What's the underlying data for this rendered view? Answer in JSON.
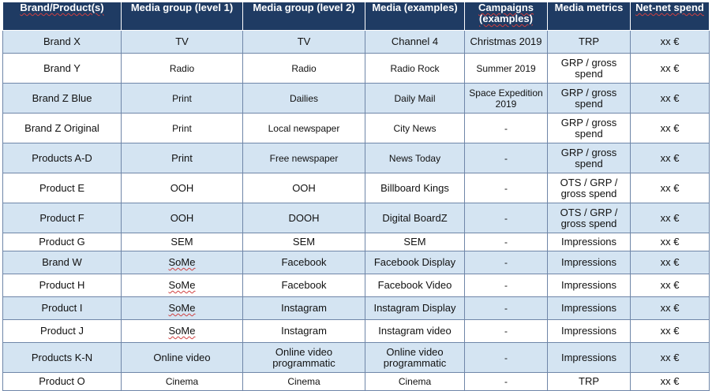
{
  "table": {
    "headers": [
      "Brand/Product(s)",
      "Media group (level 1)",
      "Media group (level 2)",
      "Media (examples)",
      "Campaigns (examples)",
      "Media metrics",
      "Net-net spend"
    ],
    "rows": [
      [
        "Brand X",
        "TV",
        "TV",
        "Channel 4",
        "Christmas 2019",
        "TRP",
        "xx €"
      ],
      [
        "Brand Y",
        "Radio",
        "Radio",
        "Radio Rock",
        "Summer 2019",
        "GRP / gross spend",
        "xx €"
      ],
      [
        "Brand Z Blue",
        "Print",
        "Dailies",
        "Daily Mail",
        "Space Expedition 2019",
        "GRP / gross spend",
        "xx €"
      ],
      [
        "Brand Z Original",
        "Print",
        "Local newspaper",
        "City News",
        "-",
        "GRP / gross spend",
        "xx €"
      ],
      [
        "Products A-D",
        "Print",
        "Free newspaper",
        "News Today",
        "-",
        "GRP / gross spend",
        "xx €"
      ],
      [
        "Product E",
        "OOH",
        "OOH",
        "Billboard Kings",
        "-",
        "OTS / GRP / gross spend",
        "xx €"
      ],
      [
        "Product F",
        "OOH",
        "DOOH",
        "Digital BoardZ",
        "-",
        "OTS / GRP / gross spend",
        "xx €"
      ],
      [
        "Product G",
        "SEM",
        "SEM",
        "SEM",
        "-",
        "Impressions",
        "xx €"
      ],
      [
        "Brand W",
        "SoMe",
        "Facebook",
        "Facebook Display",
        "-",
        "Impressions",
        "xx €"
      ],
      [
        "Product H",
        "SoMe",
        "Facebook",
        "Facebook Video",
        "-",
        "Impressions",
        "xx €"
      ],
      [
        "Product I",
        "SoMe",
        "Instagram",
        "Instagram Display",
        "-",
        "Impressions",
        "xx €"
      ],
      [
        "Product J",
        "SoMe",
        "Instagram",
        "Instagram video",
        "-",
        "Impressions",
        "xx €"
      ],
      [
        "Products K-N",
        "Online video",
        "Online video programmatic",
        "Online video programmatic",
        "-",
        "Impressions",
        "xx €"
      ],
      [
        "Product O",
        "Cinema",
        "Cinema",
        "Cinema",
        "-",
        "TRP",
        "xx €"
      ]
    ]
  }
}
